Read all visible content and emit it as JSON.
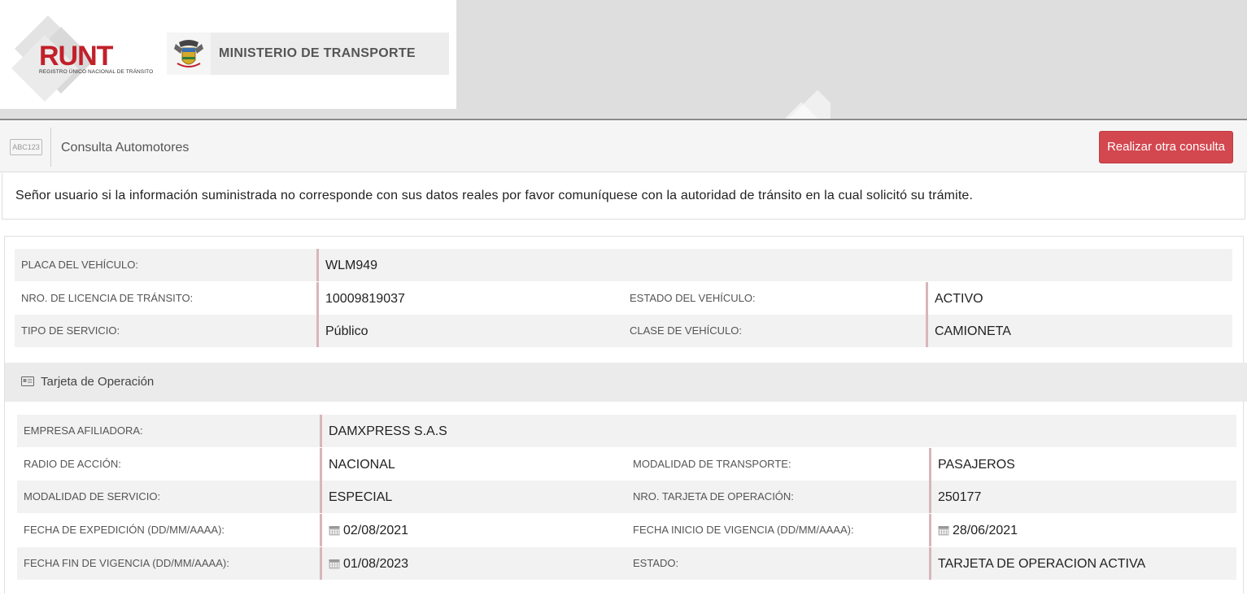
{
  "header": {
    "runt_logo_text": "RUNT",
    "runt_logo_subtitle": "REGISTRO ÚNICO NACIONAL DE TRÁNSITO",
    "ministry_text": "MINISTERIO DE TRANSPORTE"
  },
  "toolbar": {
    "plate_icon_text": "ABC123",
    "title": "Consulta Automotores",
    "new_query_button": "Realizar otra consulta"
  },
  "notice": "Señor usuario si la información suministrada no corresponde con sus datos reales por favor comuníquese con la autoridad de tránsito en la cual solicitó su trámite.",
  "vehicle": {
    "plate_label": "PLACA DEL VEHÍCULO:",
    "plate_value": "WLM949",
    "license_label": "NRO. DE LICENCIA DE TRÁNSITO:",
    "license_value": "10009819037",
    "status_label": "ESTADO DEL VEHÍCULO:",
    "status_value": "ACTIVO",
    "service_label": "TIPO DE SERVICIO:",
    "service_value": "Público",
    "class_label": "CLASE DE VEHÍCULO:",
    "class_value": "CAMIONETA"
  },
  "operation_card": {
    "section_title": "Tarjeta de Operación",
    "company_label": "EMPRESA AFILIADORA:",
    "company_value": "DAMXPRESS S.A.S",
    "radius_label": "RADIO DE ACCIÓN:",
    "radius_value": "NACIONAL",
    "transport_mode_label": "MODALIDAD DE TRANSPORTE:",
    "transport_mode_value": "PASAJEROS",
    "service_mode_label": "MODALIDAD DE SERVICIO:",
    "service_mode_value": "ESPECIAL",
    "card_number_label": "NRO. TARJETA DE OPERACIÓN:",
    "card_number_value": "250177",
    "issue_date_label": "FECHA DE EXPEDICIÓN (DD/MM/AAAA):",
    "issue_date_value": "02/08/2021",
    "start_date_label": "FECHA INICIO DE VIGENCIA (DD/MM/AAAA):",
    "start_date_value": "28/06/2021",
    "end_date_label": "FECHA FIN DE VIGENCIA (DD/MM/AAAA):",
    "end_date_value": "01/08/2023",
    "state_label": "ESTADO:",
    "state_value": "TARJETA DE OPERACION ACTIVA"
  },
  "colors": {
    "brand_red": "#c2202a",
    "button_red": "#d3474f",
    "value_divider": "#d8b6bb"
  }
}
